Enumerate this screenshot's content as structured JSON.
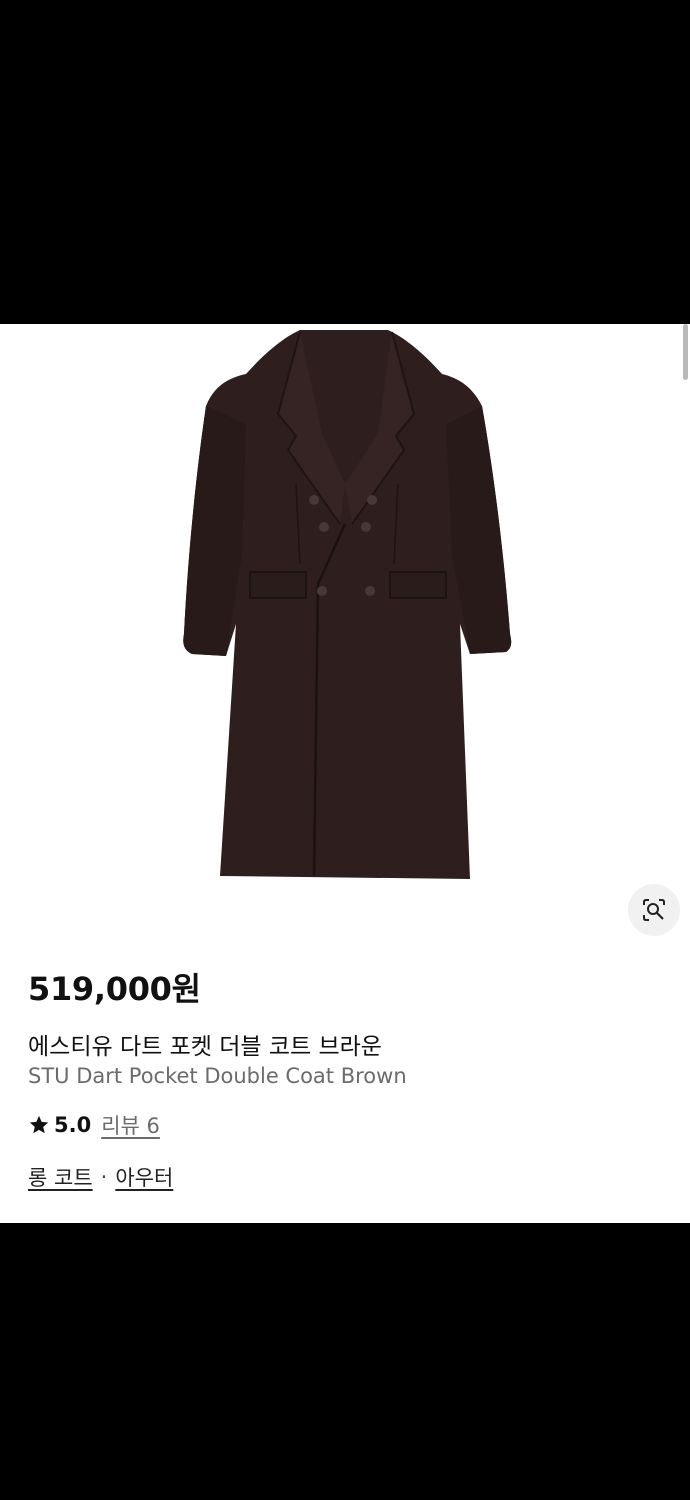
{
  "product": {
    "price": "519,000원",
    "name_ko": "에스티유 다트 포켓 더블 코트 브라운",
    "name_en": "STU Dart Pocket Double Coat Brown",
    "rating": "5.0",
    "reviews_label": "리뷰 6",
    "image_icon": "coat-image",
    "coat_color": "#2e1f1e"
  },
  "categories": {
    "primary": "롱 코트",
    "separator": "·",
    "secondary": "아우터"
  },
  "icons": {
    "lens": "lens-search-icon",
    "star": "star-icon"
  }
}
